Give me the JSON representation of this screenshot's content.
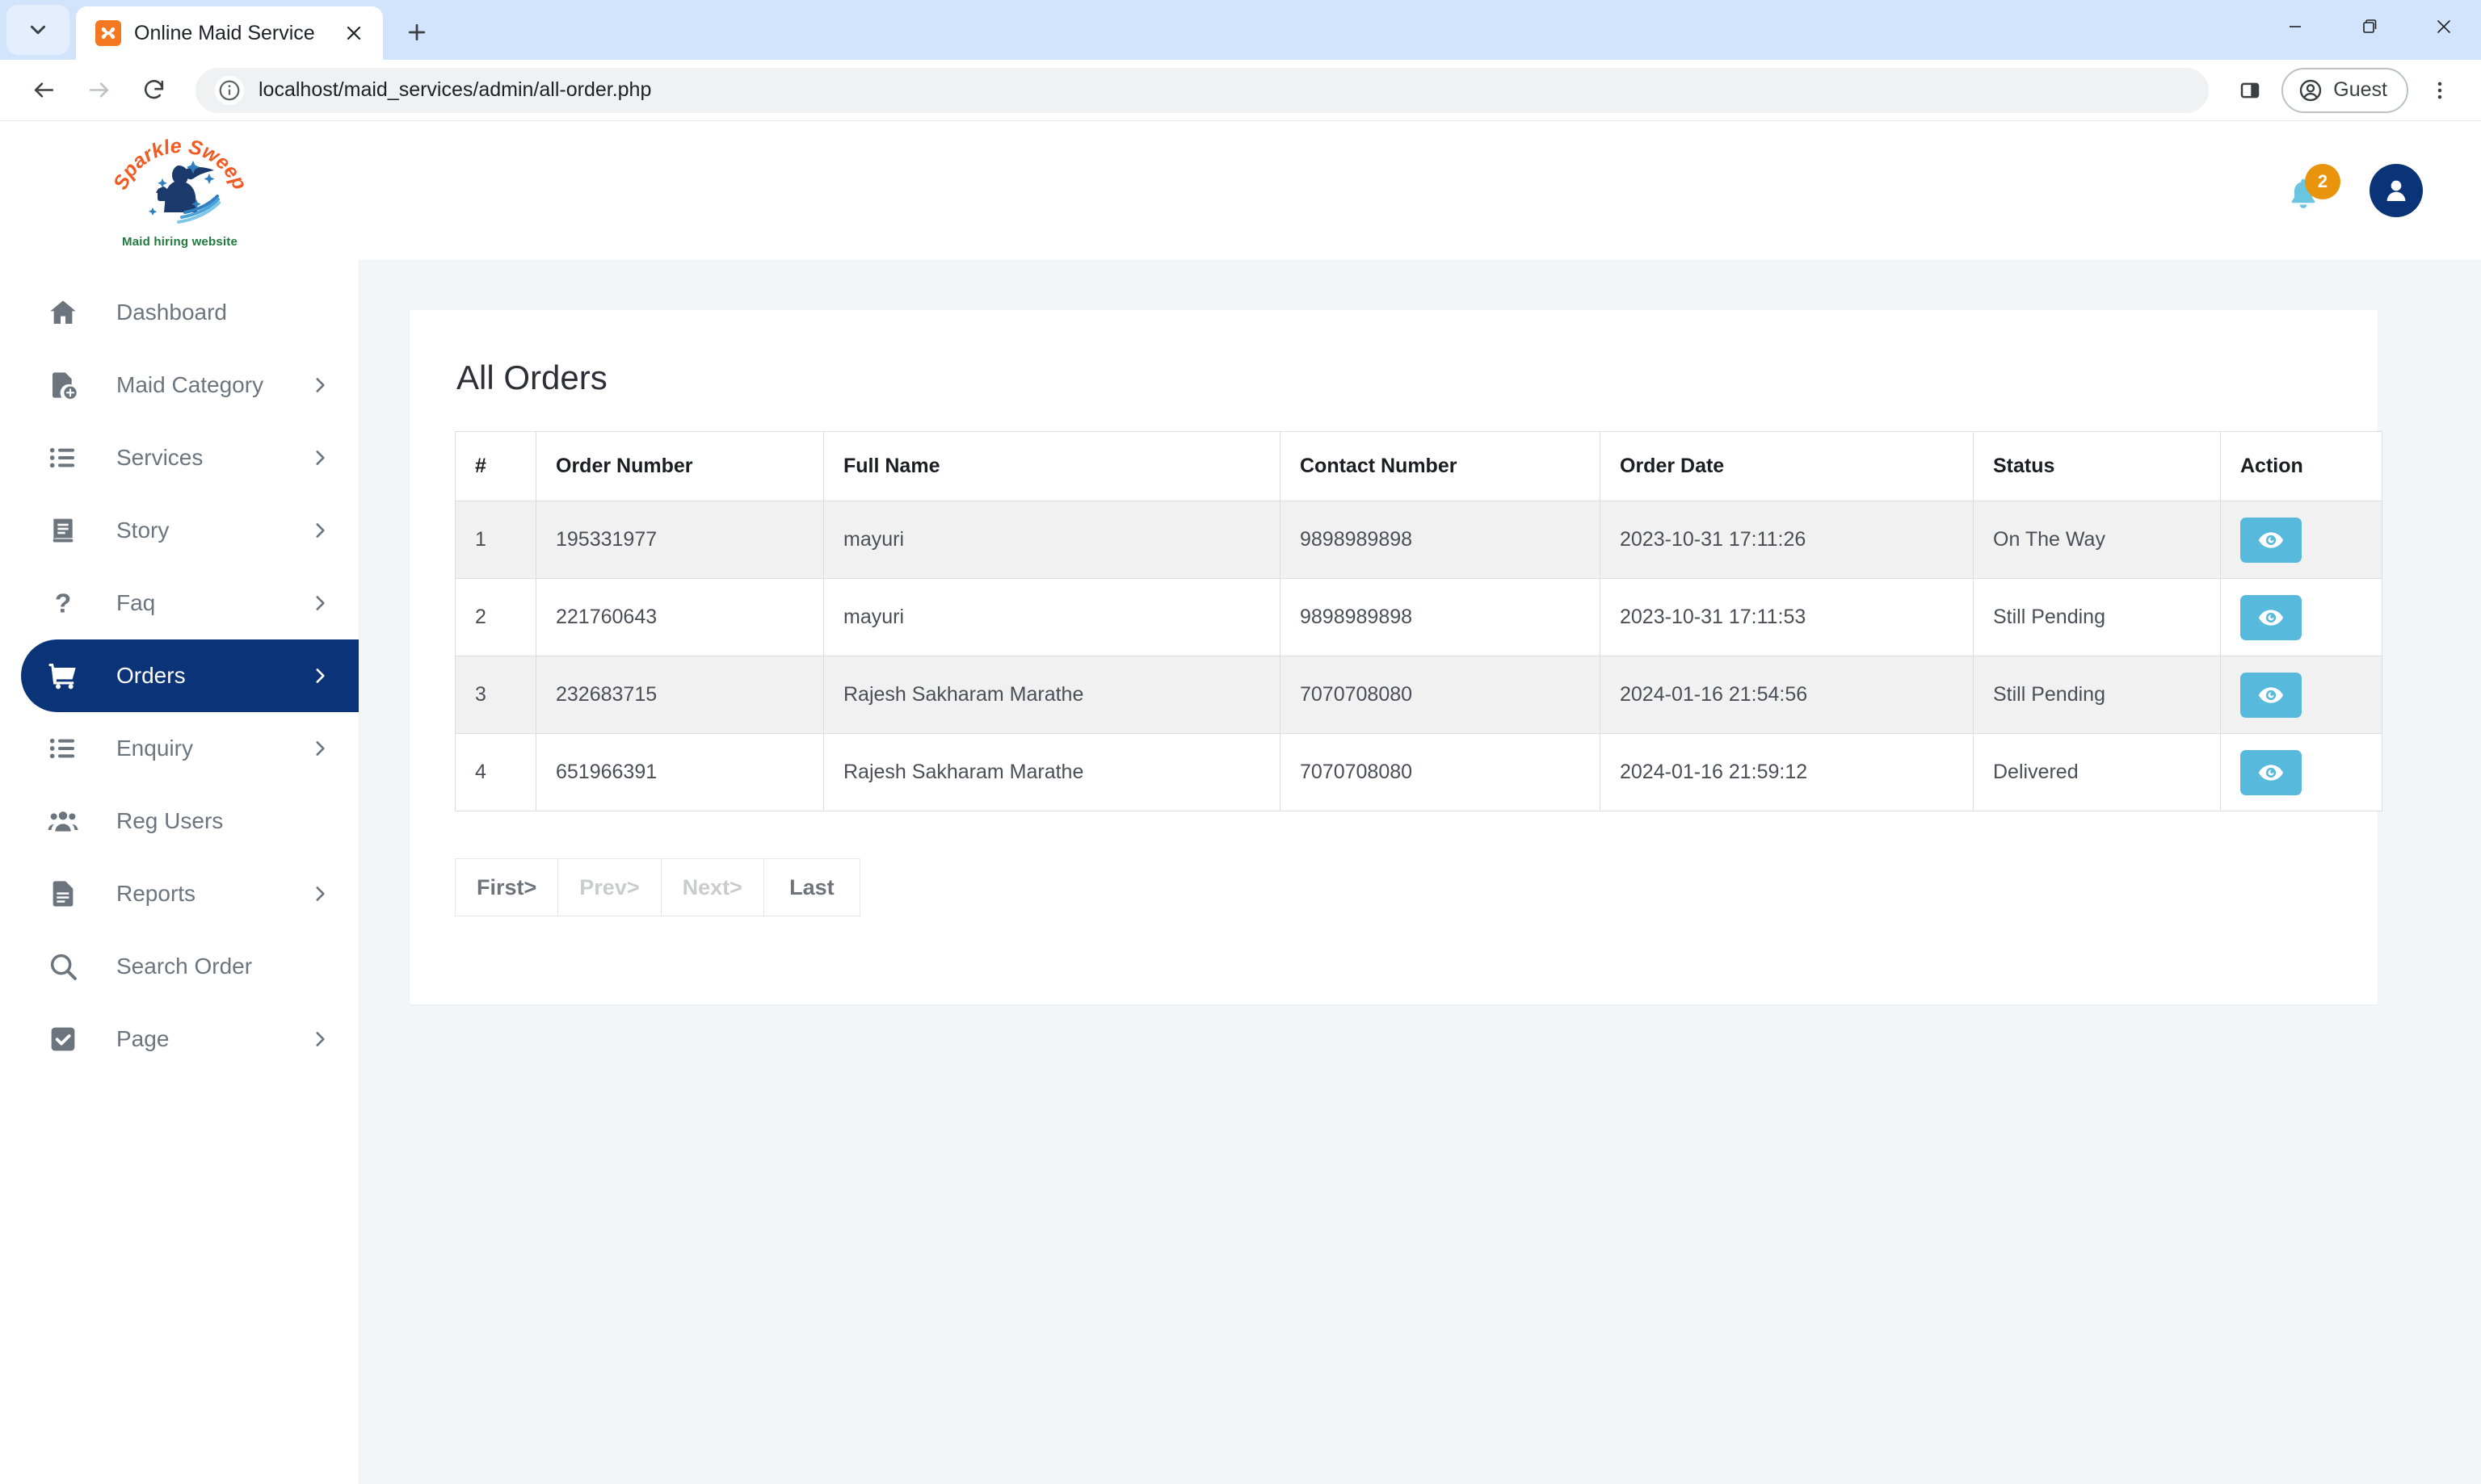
{
  "browser": {
    "tab": {
      "title": "Online Maid Service",
      "favicon_icon": "xampp-icon"
    },
    "new_tab_label": "+",
    "url": "localhost/maid_services/admin/all-order.php",
    "profile_label": "Guest",
    "icons": {
      "tab_list": "chevron-down-icon",
      "tab_close": "close-icon",
      "back": "back-arrow-icon",
      "forward": "forward-arrow-icon",
      "reload": "reload-icon",
      "site_info": "info-icon",
      "side_panel": "side-panel-icon",
      "profile": "account-circle-icon",
      "menu": "three-dot-menu-icon",
      "minimize": "minimize-icon",
      "maximize": "maximize-icon",
      "close": "window-close-icon"
    }
  },
  "header": {
    "logo_title": "Sparkle Sweep",
    "logo_tagline": "Maid hiring website",
    "notification_count": "2",
    "bell_icon": "bell-icon",
    "avatar_icon": "user-avatar-icon"
  },
  "sidebar": {
    "items": [
      {
        "label": "Dashboard",
        "icon": "home-icon",
        "chevron": false,
        "active": false
      },
      {
        "label": "Maid Category",
        "icon": "file-add-icon",
        "chevron": true,
        "active": false
      },
      {
        "label": "Services",
        "icon": "list-icon",
        "chevron": true,
        "active": false
      },
      {
        "label": "Story",
        "icon": "book-icon",
        "chevron": true,
        "active": false
      },
      {
        "label": "Faq",
        "icon": "question-icon",
        "chevron": true,
        "active": false
      },
      {
        "label": "Orders",
        "icon": "cart-icon",
        "chevron": true,
        "active": true
      },
      {
        "label": "Enquiry",
        "icon": "list-icon",
        "chevron": true,
        "active": false
      },
      {
        "label": "Reg Users",
        "icon": "users-icon",
        "chevron": false,
        "active": false
      },
      {
        "label": "Reports",
        "icon": "document-icon",
        "chevron": true,
        "active": false
      },
      {
        "label": "Search Order",
        "icon": "search-icon",
        "chevron": false,
        "active": false
      },
      {
        "label": "Page",
        "icon": "checkbox-icon",
        "chevron": true,
        "active": false
      }
    ]
  },
  "main": {
    "title": "All Orders",
    "table": {
      "columns": [
        "#",
        "Order Number",
        "Full Name",
        "Contact Number",
        "Order Date",
        "Status",
        "Action"
      ],
      "rows": [
        {
          "num": "1",
          "order_number": "195331977",
          "full_name": "mayuri",
          "contact": "9898989898",
          "order_date": "2023-10-31 17:11:26",
          "status": "On The Way",
          "action_icon": "eye-icon"
        },
        {
          "num": "2",
          "order_number": "221760643",
          "full_name": "mayuri",
          "contact": "9898989898",
          "order_date": "2023-10-31 17:11:53",
          "status": "Still Pending",
          "action_icon": "eye-icon"
        },
        {
          "num": "3",
          "order_number": "232683715",
          "full_name": "Rajesh Sakharam Marathe",
          "contact": "7070708080",
          "order_date": "2024-01-16 21:54:56",
          "status": "Still Pending",
          "action_icon": "eye-icon"
        },
        {
          "num": "4",
          "order_number": "651966391",
          "full_name": "Rajesh Sakharam Marathe",
          "contact": "7070708080",
          "order_date": "2024-01-16 21:59:12",
          "status": "Delivered",
          "action_icon": "eye-icon"
        }
      ]
    },
    "pagination": [
      {
        "label": "First>",
        "disabled": false
      },
      {
        "label": "Prev>",
        "disabled": true
      },
      {
        "label": "Next>",
        "disabled": true
      },
      {
        "label": "Last",
        "disabled": false
      }
    ]
  },
  "colors": {
    "sidebar_active": "#0b3378",
    "accent_orange": "#e8940c",
    "action_blue": "#57b9dc",
    "page_bg": "#f3f6f9",
    "logo_orange": "#f15a22",
    "logo_navy": "#1b3a6b",
    "logo_green": "#1f7a3d"
  }
}
